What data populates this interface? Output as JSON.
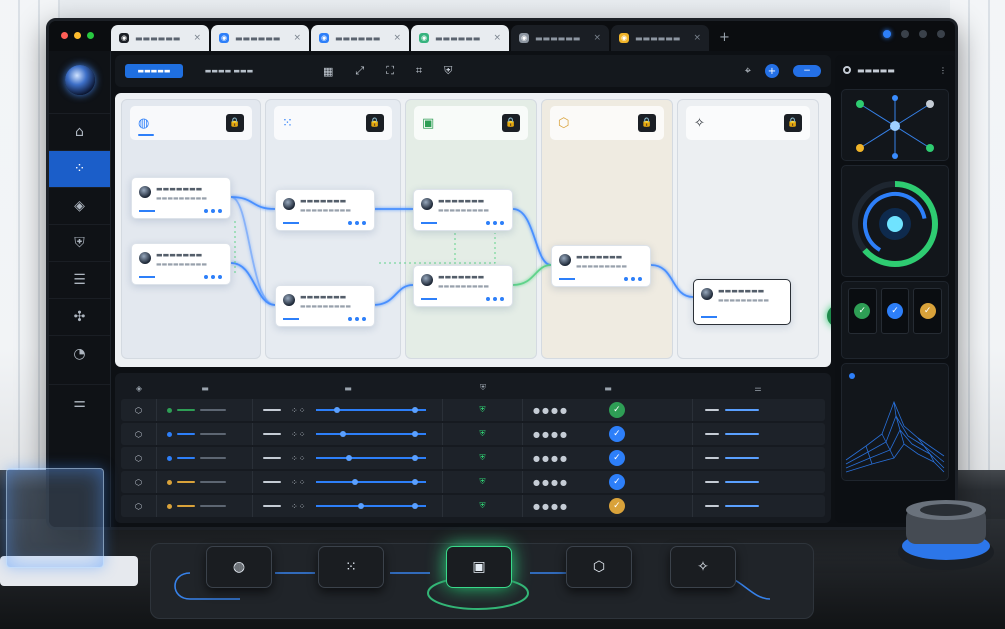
{
  "window": {
    "tabs": [
      {
        "label": "▬▬▬▬▬▬",
        "icon": "◉",
        "color": "#1b1f25",
        "active": true
      },
      {
        "label": "▬▬▬▬▬▬",
        "icon": "◉",
        "color": "#2d7ff9",
        "active": true
      },
      {
        "label": "▬▬▬▬▬▬",
        "icon": "◉",
        "color": "#2d7ff9",
        "active": true
      },
      {
        "label": "▬▬▬▬▬▬",
        "icon": "◉",
        "color": "#36b37e",
        "active": true
      },
      {
        "label": "▬▬▬▬▬▬",
        "icon": "◉",
        "color": "#8d96a1",
        "active": false
      },
      {
        "label": "▬▬▬▬▬▬",
        "icon": "◉",
        "color": "#f0b429",
        "active": false
      }
    ],
    "close_glyph": "×",
    "add_glyph": "+"
  },
  "rail": {
    "items": [
      {
        "name": "home-icon",
        "glyph": "⌂"
      },
      {
        "name": "network-icon",
        "glyph": "⁘"
      },
      {
        "name": "layers-icon",
        "glyph": "◈"
      },
      {
        "name": "shield-icon",
        "glyph": "⛨"
      },
      {
        "name": "database-icon",
        "glyph": "☰"
      },
      {
        "name": "graph-icon",
        "glyph": "✣"
      },
      {
        "name": "pie-chart-icon",
        "glyph": "◔"
      },
      {
        "name": "sliders-icon",
        "glyph": "⚌"
      }
    ]
  },
  "toolbar": {
    "primary_label": "▬▬▬▬▬",
    "secondary_label": "▬▬▬▬  ▬▬▬",
    "icons": [
      "▦",
      "⤢",
      "⛶",
      "⌗",
      "⛨"
    ],
    "right_icons": [
      "⌖"
    ],
    "plus": "+",
    "minus": "−"
  },
  "lanes": [
    {
      "icon": "◍",
      "label": "",
      "color": "#2d7ff9",
      "bg": "#e3e8ef"
    },
    {
      "icon": "⁙",
      "label": "",
      "color": "#2d7ff9",
      "bg": "#e6ebf1"
    },
    {
      "icon": "▣",
      "label": "",
      "color": "#2e9e55",
      "bg": "#e4ede6"
    },
    {
      "icon": "⬡",
      "label": "",
      "color": "#d9a23a",
      "bg": "#efebe1"
    },
    {
      "icon": "✧",
      "label": "",
      "color": "#2b3037",
      "bg": "#eceff2"
    }
  ],
  "lock_glyph": "🔒",
  "nodes": [
    {
      "title": "▬▬▬▬▬▬▬",
      "sub": "▬▬▬▬▬▬▬▬▬"
    },
    {
      "title": "▬▬▬▬▬▬▬",
      "sub": "▬▬▬▬▬▬▬▬▬"
    },
    {
      "title": "▬▬▬▬▬▬▬",
      "sub": "▬▬▬▬▬▬▬▬▬"
    },
    {
      "title": "▬▬▬▬▬▬▬",
      "sub": "▬▬▬▬▬▬▬▬▬"
    },
    {
      "title": "▬▬▬▬▬▬▬",
      "sub": "▬▬▬▬▬▬▬▬▬"
    },
    {
      "title": "▬▬▬▬▬▬▬",
      "sub": "▬▬▬▬▬▬▬▬▬"
    },
    {
      "title": "▬▬▬▬▬▬▬",
      "sub": "▬▬▬▬▬▬▬▬▬"
    },
    {
      "title": "▬▬▬▬▬▬▬",
      "sub": "▬▬▬▬▬▬▬▬▬"
    }
  ],
  "check_glyph": "✓",
  "table": {
    "header_icons": [
      "◈",
      "▬",
      "▬",
      "⛨",
      "▬",
      "⚌"
    ],
    "rows": [
      {
        "status": "#2e9e55",
        "check": "#2e9e55"
      },
      {
        "status": "#2d7ff9",
        "check": "#2d7ff9"
      },
      {
        "status": "#2d7ff9",
        "check": "#2d7ff9"
      },
      {
        "status": "#d9a23a",
        "check": "#2d7ff9"
      },
      {
        "status": "#d9a23a",
        "check": "#d9a23a"
      }
    ],
    "row_icon": "⬡",
    "shield_glyph": "⛨"
  },
  "right_panel": {
    "title": "▬▬▬▬▬",
    "menu_glyph": "⋮"
  },
  "keys": [
    {
      "name": "globe-key",
      "glyph": "◍"
    },
    {
      "name": "grid-key",
      "glyph": "⁙"
    },
    {
      "name": "chip-key",
      "glyph": "▣"
    },
    {
      "name": "hexagon-key",
      "glyph": "⬡"
    },
    {
      "name": "sparkle-key",
      "glyph": "✧"
    }
  ]
}
